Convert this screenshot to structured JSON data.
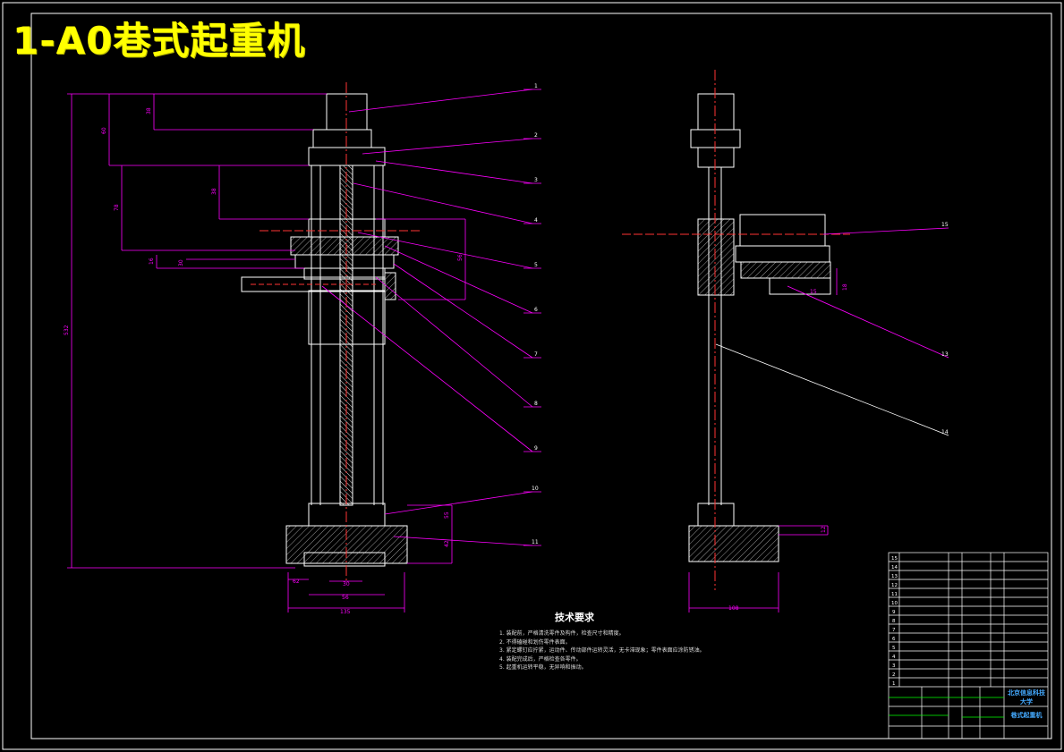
{
  "title": "1-A0巷式起重机",
  "technical_requirements": {
    "heading": "技术要求",
    "notes": [
      "1. 装配前，严格清洗零件及构件，检查尺寸和精度。",
      "2. 不得磕碰和划伤零件表面。",
      "3. 紧定螺钉应拧紧，运动件、传动部件运转灵活，无卡滞现象；零件表面应涂防锈油。",
      "4. 装配完成后，严格检查各零件。",
      "5. 起重机运转平稳，无异响和振动。"
    ]
  },
  "part_labels_front": [
    "1",
    "2",
    "3",
    "4",
    "5",
    "6",
    "7",
    "8",
    "9",
    "10",
    "11"
  ],
  "part_labels_side": [
    "15",
    "13",
    "14"
  ],
  "dimensions_front": [
    "532",
    "38",
    "60",
    "78",
    "38",
    "56",
    "30",
    "56",
    "135",
    "55",
    "16",
    "30",
    "42",
    "62"
  ],
  "dimensions_side": [
    "108",
    "12",
    "15",
    "18"
  ],
  "title_block": {
    "school": "北京信息科技大学",
    "drawing_name": "巷式起重机",
    "bom_rows": [
      "15",
      "14",
      "13",
      "12",
      "11",
      "10",
      "9",
      "8",
      "7",
      "6",
      "5",
      "4",
      "3",
      "2",
      "1"
    ]
  },
  "colors": {
    "background": "#000000",
    "outline": "#ffffff",
    "dimension": "#ff00ff",
    "centerline": "#ff3333",
    "title": "#ffff00",
    "titleblock_text": "#44aaff",
    "titleblock_green": "#00ff00"
  }
}
